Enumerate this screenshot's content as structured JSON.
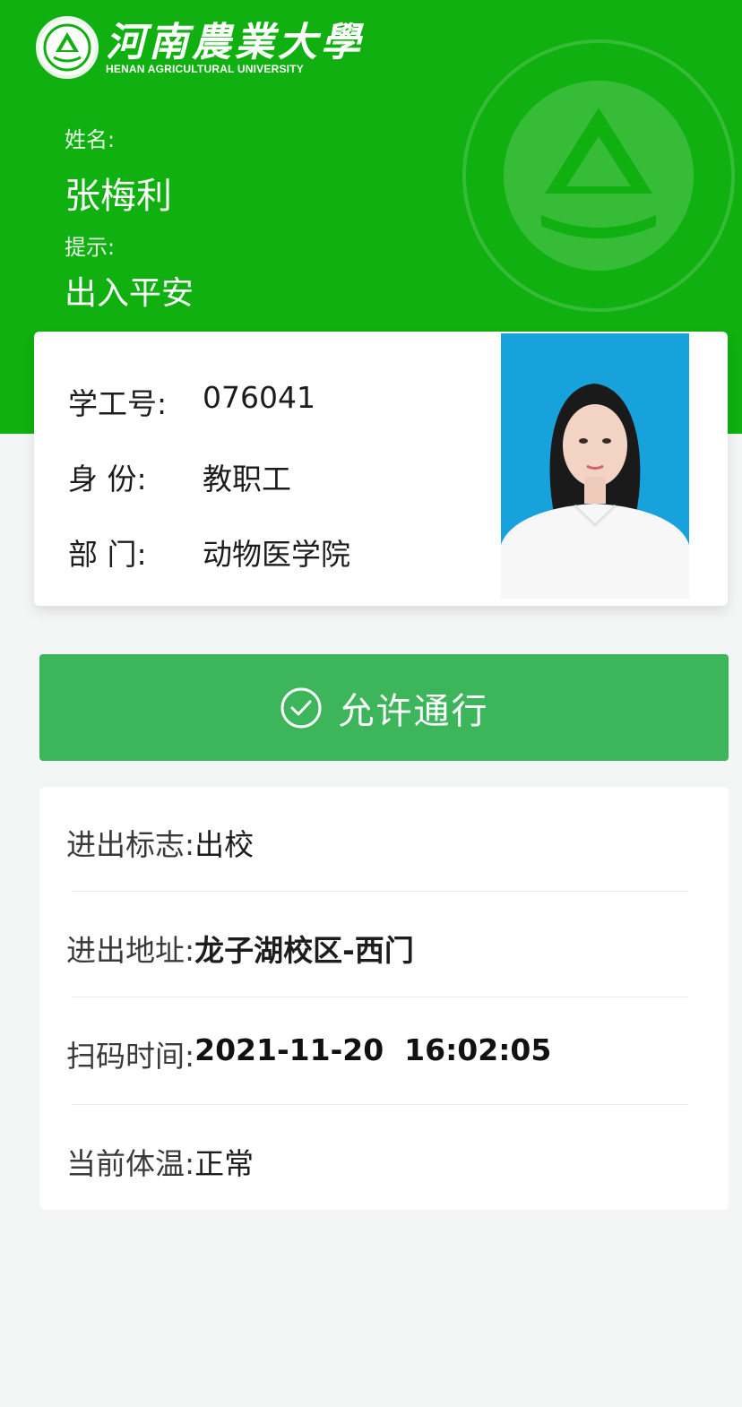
{
  "header": {
    "university_cn": "河南農業大學",
    "university_en": "HENAN AGRICULTURAL UNIVERSITY",
    "name_label": "姓名:",
    "name_value": "张梅利",
    "tip_label": "提示:",
    "tip_value": "出入平安"
  },
  "profile": {
    "id_label": "学工号:",
    "id_value": "076041",
    "role_label": "身 份:",
    "role_value": "教职工",
    "dept_label": "部 门:",
    "dept_value": "动物医学院"
  },
  "status": {
    "label": "允许通行",
    "icon": "check-circle-icon"
  },
  "details": {
    "direction_label": "进出标志:",
    "direction_value": "出校",
    "location_label": "进出地址:",
    "location_value": "龙子湖校区-西门",
    "scan_time_label": "扫码时间:",
    "scan_time_value": "2021-11-20  16:02:05",
    "temperature_label": "当前体温:",
    "temperature_value": "正常"
  },
  "colors": {
    "header_green": "#0fb00f",
    "pass_green": "#3cb55b",
    "photo_bg": "#17a2dc"
  }
}
